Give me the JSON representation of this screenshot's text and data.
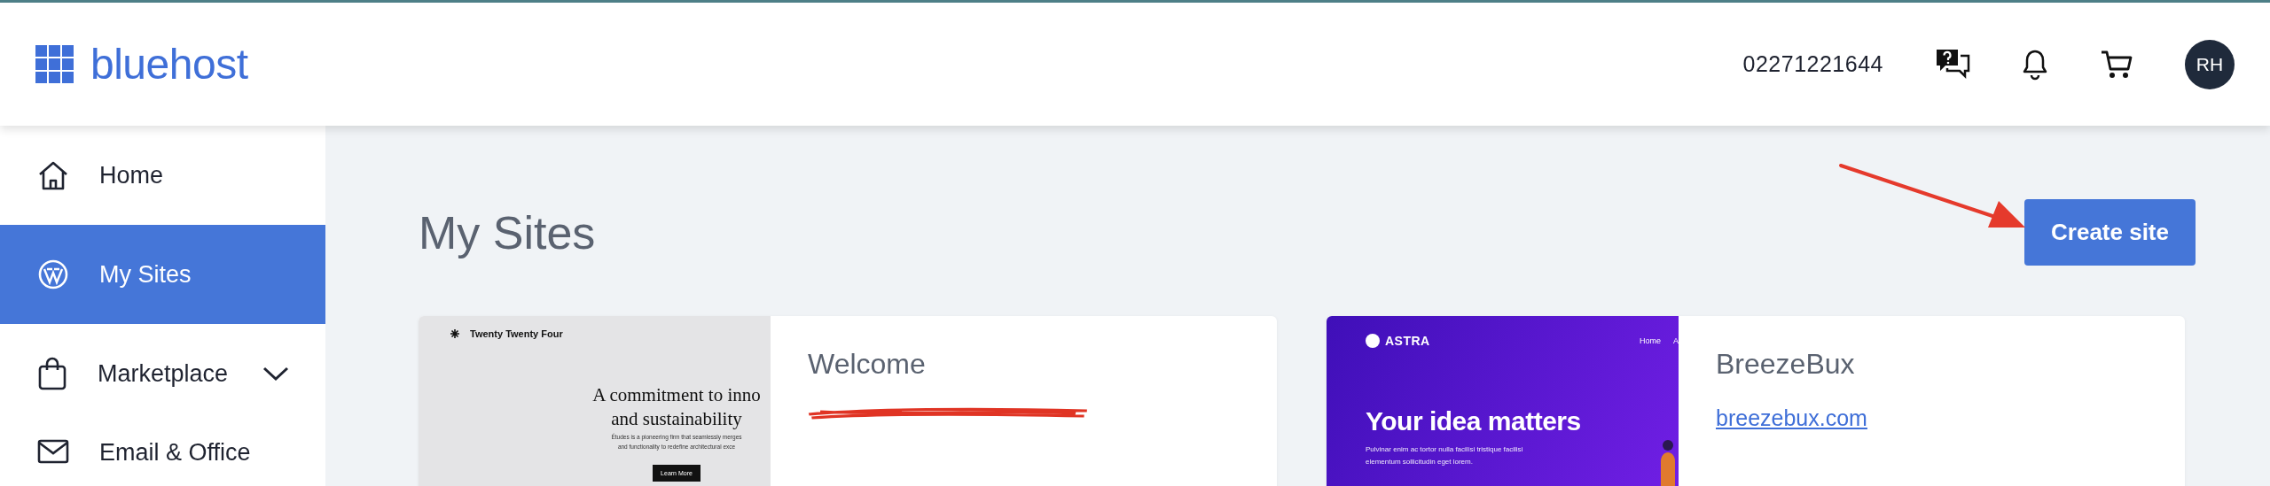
{
  "header": {
    "logo": "bluehost",
    "phone": "02271221644",
    "avatar": "RH"
  },
  "sidebar": {
    "items": [
      {
        "label": "Home",
        "kind": "home",
        "selected": false,
        "expandable": false
      },
      {
        "label": "My Sites",
        "kind": "wordpress",
        "selected": true,
        "expandable": false
      },
      {
        "label": "Marketplace",
        "kind": "bag",
        "selected": false,
        "expandable": true
      },
      {
        "label": "Email & Office",
        "kind": "mail",
        "selected": false,
        "expandable": false
      }
    ]
  },
  "page": {
    "title": "My Sites",
    "create_button": "Create site"
  },
  "sites": [
    {
      "name": "Welcome",
      "redacted": true,
      "preview": {
        "kind": "twenty-twenty-four",
        "site_title": "Twenty Twenty Four",
        "headline": [
          "A commitment to inno",
          "and sustainability"
        ],
        "body": [
          "Études is a pioneering firm that seamlessly merges",
          "and functionality to redefine architectural exce"
        ],
        "button": "Learn More"
      }
    },
    {
      "name": "BreezeBux",
      "redacted": false,
      "url": "breezebux.com",
      "preview": {
        "kind": "astra",
        "brand": "ASTRA",
        "nav": [
          "Home",
          "A"
        ],
        "headline": "Your idea matters",
        "body": [
          "Pulvinar enim ac tortor nulla facilisi tristique facilisi",
          "elementum sollicitudin eget lorem."
        ]
      }
    }
  ]
}
